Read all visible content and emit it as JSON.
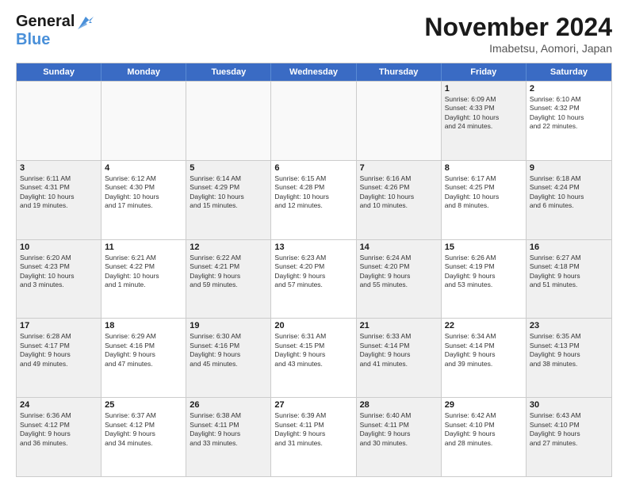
{
  "header": {
    "logo_line1": "General",
    "logo_line2": "Blue",
    "month": "November 2024",
    "location": "Imabetsu, Aomori, Japan"
  },
  "days_of_week": [
    "Sunday",
    "Monday",
    "Tuesday",
    "Wednesday",
    "Thursday",
    "Friday",
    "Saturday"
  ],
  "rows": [
    [
      {
        "day": "",
        "info": "",
        "empty": true
      },
      {
        "day": "",
        "info": "",
        "empty": true
      },
      {
        "day": "",
        "info": "",
        "empty": true
      },
      {
        "day": "",
        "info": "",
        "empty": true
      },
      {
        "day": "",
        "info": "",
        "empty": true
      },
      {
        "day": "1",
        "info": "Sunrise: 6:09 AM\nSunset: 4:33 PM\nDaylight: 10 hours\nand 24 minutes.",
        "shaded": true
      },
      {
        "day": "2",
        "info": "Sunrise: 6:10 AM\nSunset: 4:32 PM\nDaylight: 10 hours\nand 22 minutes.",
        "shaded": false
      }
    ],
    [
      {
        "day": "3",
        "info": "Sunrise: 6:11 AM\nSunset: 4:31 PM\nDaylight: 10 hours\nand 19 minutes.",
        "shaded": true
      },
      {
        "day": "4",
        "info": "Sunrise: 6:12 AM\nSunset: 4:30 PM\nDaylight: 10 hours\nand 17 minutes.",
        "shaded": false
      },
      {
        "day": "5",
        "info": "Sunrise: 6:14 AM\nSunset: 4:29 PM\nDaylight: 10 hours\nand 15 minutes.",
        "shaded": true
      },
      {
        "day": "6",
        "info": "Sunrise: 6:15 AM\nSunset: 4:28 PM\nDaylight: 10 hours\nand 12 minutes.",
        "shaded": false
      },
      {
        "day": "7",
        "info": "Sunrise: 6:16 AM\nSunset: 4:26 PM\nDaylight: 10 hours\nand 10 minutes.",
        "shaded": true
      },
      {
        "day": "8",
        "info": "Sunrise: 6:17 AM\nSunset: 4:25 PM\nDaylight: 10 hours\nand 8 minutes.",
        "shaded": false
      },
      {
        "day": "9",
        "info": "Sunrise: 6:18 AM\nSunset: 4:24 PM\nDaylight: 10 hours\nand 6 minutes.",
        "shaded": true
      }
    ],
    [
      {
        "day": "10",
        "info": "Sunrise: 6:20 AM\nSunset: 4:23 PM\nDaylight: 10 hours\nand 3 minutes.",
        "shaded": true
      },
      {
        "day": "11",
        "info": "Sunrise: 6:21 AM\nSunset: 4:22 PM\nDaylight: 10 hours\nand 1 minute.",
        "shaded": false
      },
      {
        "day": "12",
        "info": "Sunrise: 6:22 AM\nSunset: 4:21 PM\nDaylight: 9 hours\nand 59 minutes.",
        "shaded": true
      },
      {
        "day": "13",
        "info": "Sunrise: 6:23 AM\nSunset: 4:20 PM\nDaylight: 9 hours\nand 57 minutes.",
        "shaded": false
      },
      {
        "day": "14",
        "info": "Sunrise: 6:24 AM\nSunset: 4:20 PM\nDaylight: 9 hours\nand 55 minutes.",
        "shaded": true
      },
      {
        "day": "15",
        "info": "Sunrise: 6:26 AM\nSunset: 4:19 PM\nDaylight: 9 hours\nand 53 minutes.",
        "shaded": false
      },
      {
        "day": "16",
        "info": "Sunrise: 6:27 AM\nSunset: 4:18 PM\nDaylight: 9 hours\nand 51 minutes.",
        "shaded": true
      }
    ],
    [
      {
        "day": "17",
        "info": "Sunrise: 6:28 AM\nSunset: 4:17 PM\nDaylight: 9 hours\nand 49 minutes.",
        "shaded": true
      },
      {
        "day": "18",
        "info": "Sunrise: 6:29 AM\nSunset: 4:16 PM\nDaylight: 9 hours\nand 47 minutes.",
        "shaded": false
      },
      {
        "day": "19",
        "info": "Sunrise: 6:30 AM\nSunset: 4:16 PM\nDaylight: 9 hours\nand 45 minutes.",
        "shaded": true
      },
      {
        "day": "20",
        "info": "Sunrise: 6:31 AM\nSunset: 4:15 PM\nDaylight: 9 hours\nand 43 minutes.",
        "shaded": false
      },
      {
        "day": "21",
        "info": "Sunrise: 6:33 AM\nSunset: 4:14 PM\nDaylight: 9 hours\nand 41 minutes.",
        "shaded": true
      },
      {
        "day": "22",
        "info": "Sunrise: 6:34 AM\nSunset: 4:14 PM\nDaylight: 9 hours\nand 39 minutes.",
        "shaded": false
      },
      {
        "day": "23",
        "info": "Sunrise: 6:35 AM\nSunset: 4:13 PM\nDaylight: 9 hours\nand 38 minutes.",
        "shaded": true
      }
    ],
    [
      {
        "day": "24",
        "info": "Sunrise: 6:36 AM\nSunset: 4:12 PM\nDaylight: 9 hours\nand 36 minutes.",
        "shaded": true
      },
      {
        "day": "25",
        "info": "Sunrise: 6:37 AM\nSunset: 4:12 PM\nDaylight: 9 hours\nand 34 minutes.",
        "shaded": false
      },
      {
        "day": "26",
        "info": "Sunrise: 6:38 AM\nSunset: 4:11 PM\nDaylight: 9 hours\nand 33 minutes.",
        "shaded": true
      },
      {
        "day": "27",
        "info": "Sunrise: 6:39 AM\nSunset: 4:11 PM\nDaylight: 9 hours\nand 31 minutes.",
        "shaded": false
      },
      {
        "day": "28",
        "info": "Sunrise: 6:40 AM\nSunset: 4:11 PM\nDaylight: 9 hours\nand 30 minutes.",
        "shaded": true
      },
      {
        "day": "29",
        "info": "Sunrise: 6:42 AM\nSunset: 4:10 PM\nDaylight: 9 hours\nand 28 minutes.",
        "shaded": false
      },
      {
        "day": "30",
        "info": "Sunrise: 6:43 AM\nSunset: 4:10 PM\nDaylight: 9 hours\nand 27 minutes.",
        "shaded": true
      }
    ]
  ]
}
